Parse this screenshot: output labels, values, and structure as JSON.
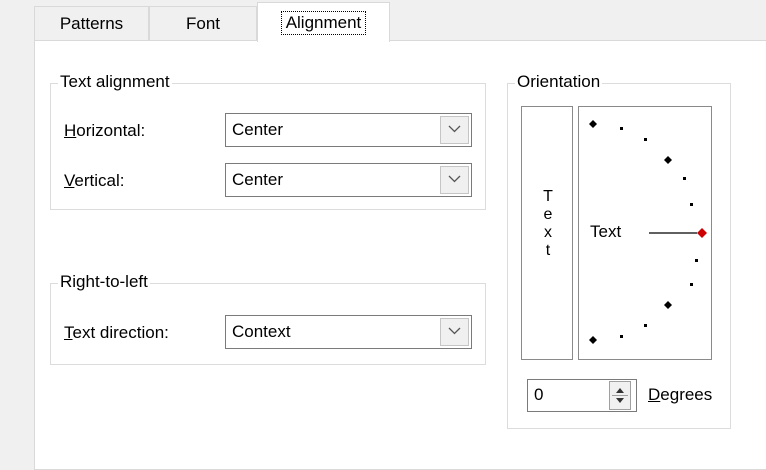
{
  "tabs": [
    {
      "label": "Patterns"
    },
    {
      "label": "Font"
    },
    {
      "label": "Alignment",
      "active": true
    }
  ],
  "text_alignment": {
    "title": "Text alignment",
    "horizontal": {
      "label_hotkey": "H",
      "label_rest": "orizontal:",
      "value": "Center"
    },
    "vertical": {
      "label_hotkey": "V",
      "label_rest": "ertical:",
      "value": "Center"
    }
  },
  "rtl": {
    "title": "Right-to-left",
    "text_direction": {
      "label_hotkey": "T",
      "label_rest": "ext direction:",
      "value": "Context"
    }
  },
  "orientation": {
    "title": "Orientation",
    "vertical_text": [
      "T",
      "e",
      "x",
      "t"
    ],
    "dial_label": "Text",
    "degrees_value": "0",
    "degrees_label_hotkey": "D",
    "degrees_label_rest": "egrees",
    "marker_color": "#cc0000"
  }
}
